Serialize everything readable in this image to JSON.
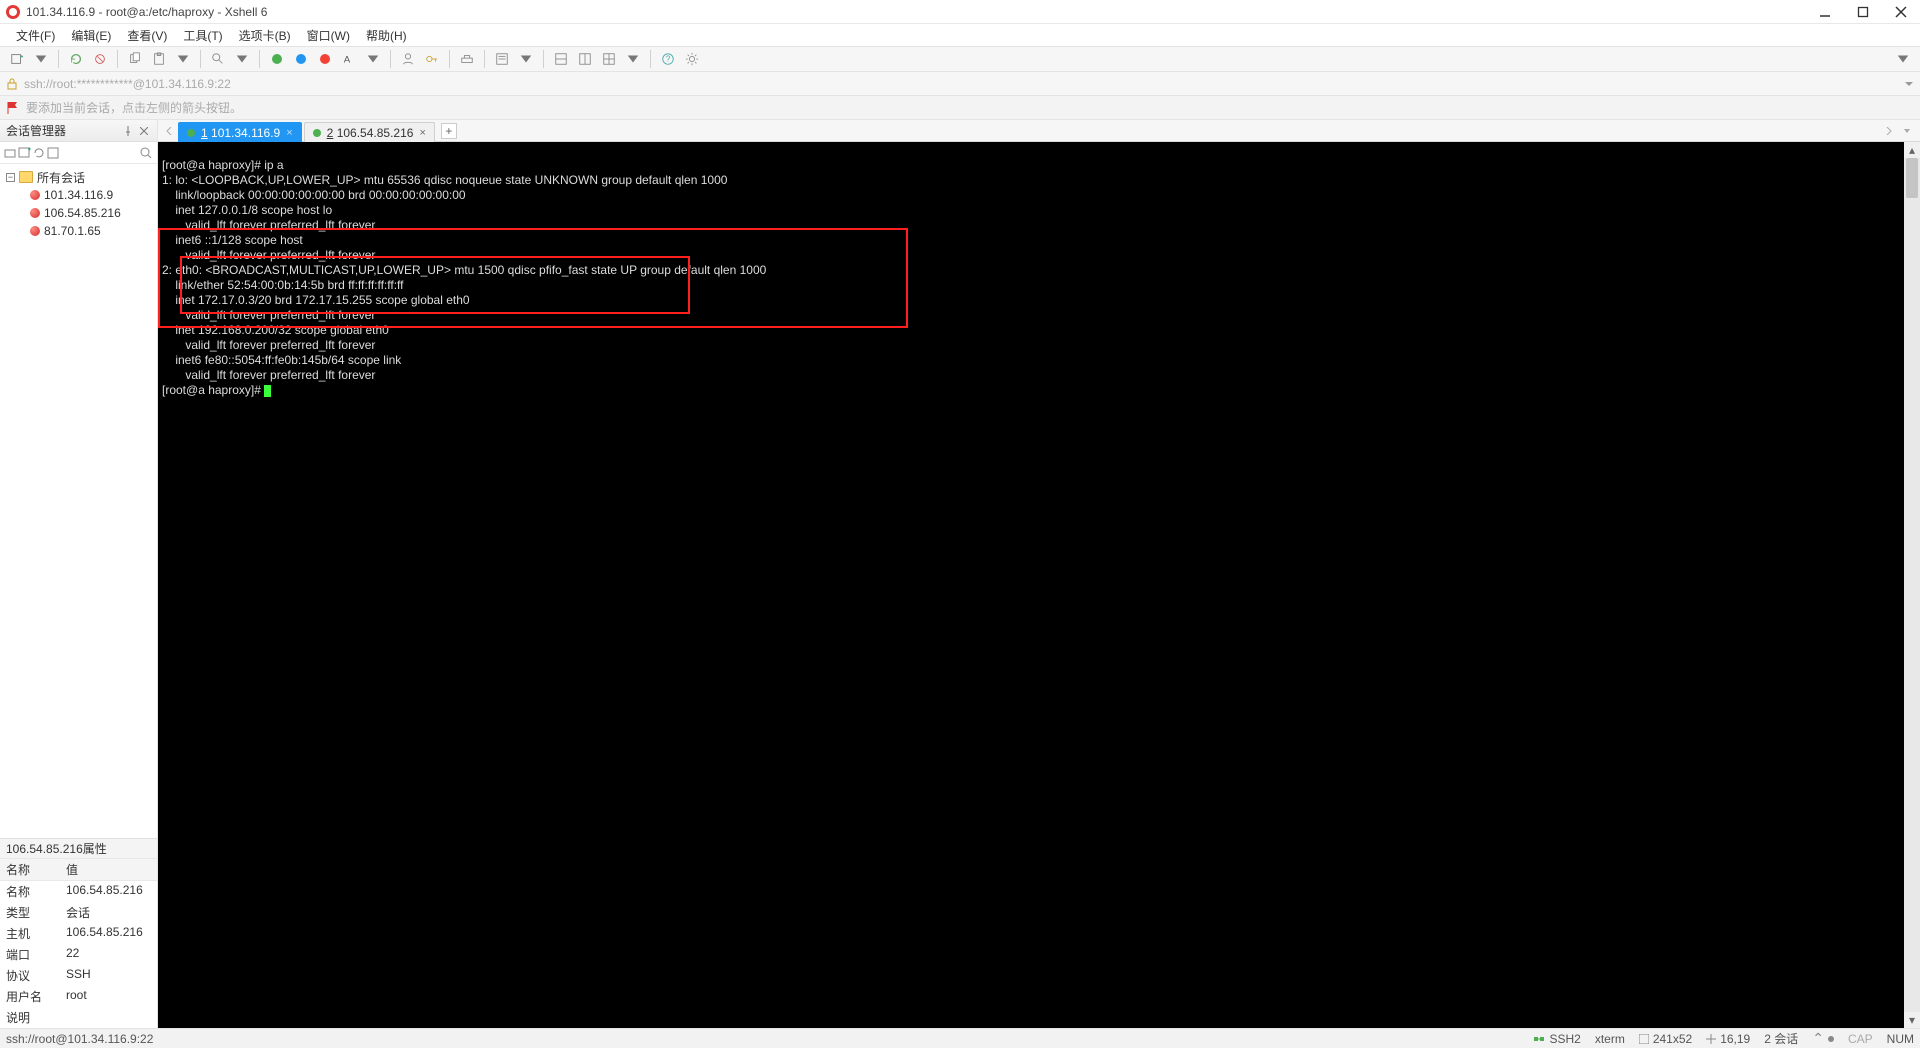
{
  "window": {
    "title": "101.34.116.9 - root@a:/etc/haproxy - Xshell 6"
  },
  "menus": [
    "文件(F)",
    "编辑(E)",
    "查看(V)",
    "工具(T)",
    "选项卡(B)",
    "窗口(W)",
    "帮助(H)"
  ],
  "address_bar": {
    "text": "ssh://root:************@101.34.116.9:22"
  },
  "hint_bar": {
    "text": "要添加当前会话，点击左侧的箭头按钮。"
  },
  "sidebar": {
    "title": "会话管理器",
    "root_label": "所有会话",
    "sessions": [
      "101.34.116.9",
      "106.54.85.216",
      "81.70.1.65"
    ]
  },
  "properties": {
    "title": "106.54.85.216属性",
    "header_key": "名称",
    "header_val": "值",
    "rows": [
      {
        "k": "名称",
        "v": "106.54.85.216"
      },
      {
        "k": "类型",
        "v": "会话"
      },
      {
        "k": "主机",
        "v": "106.54.85.216"
      },
      {
        "k": "端口",
        "v": "22"
      },
      {
        "k": "协议",
        "v": "SSH"
      },
      {
        "k": "用户名",
        "v": "root"
      },
      {
        "k": "说明",
        "v": ""
      }
    ]
  },
  "tabs": [
    {
      "num": "1",
      "label": "101.34.116.9",
      "active": true
    },
    {
      "num": "2",
      "label": "106.54.85.216",
      "active": false
    }
  ],
  "terminal": {
    "prompt1": "[root@a haproxy]# ip a",
    "lines": [
      "1: lo: <LOOPBACK,UP,LOWER_UP> mtu 65536 qdisc noqueue state UNKNOWN group default qlen 1000",
      "    link/loopback 00:00:00:00:00:00 brd 00:00:00:00:00:00",
      "    inet 127.0.0.1/8 scope host lo",
      "       valid_lft forever preferred_lft forever",
      "    inet6 ::1/128 scope host",
      "       valid_lft forever preferred_lft forever",
      "2: eth0: <BROADCAST,MULTICAST,UP,LOWER_UP> mtu 1500 qdisc pfifo_fast state UP group default qlen 1000",
      "    link/ether 52:54:00:0b:14:5b brd ff:ff:ff:ff:ff:ff",
      "    inet 172.17.0.3/20 brd 172.17.15.255 scope global eth0",
      "       valid_lft forever preferred_lft forever",
      "    inet 192.168.0.200/32 scope global eth0",
      "       valid_lft forever preferred_lft forever",
      "    inet6 fe80::5054:ff:fe0b:145b/64 scope link",
      "       valid_lft forever preferred_lft forever"
    ],
    "prompt2": "[root@a haproxy]# "
  },
  "statusbar": {
    "left": "ssh://root@101.34.116.9:22",
    "ssh": "SSH2",
    "term": "xterm",
    "size": "241x52",
    "pos": "16,19",
    "sessions": "2 会话",
    "cap": "CAP",
    "num": "NUM"
  }
}
